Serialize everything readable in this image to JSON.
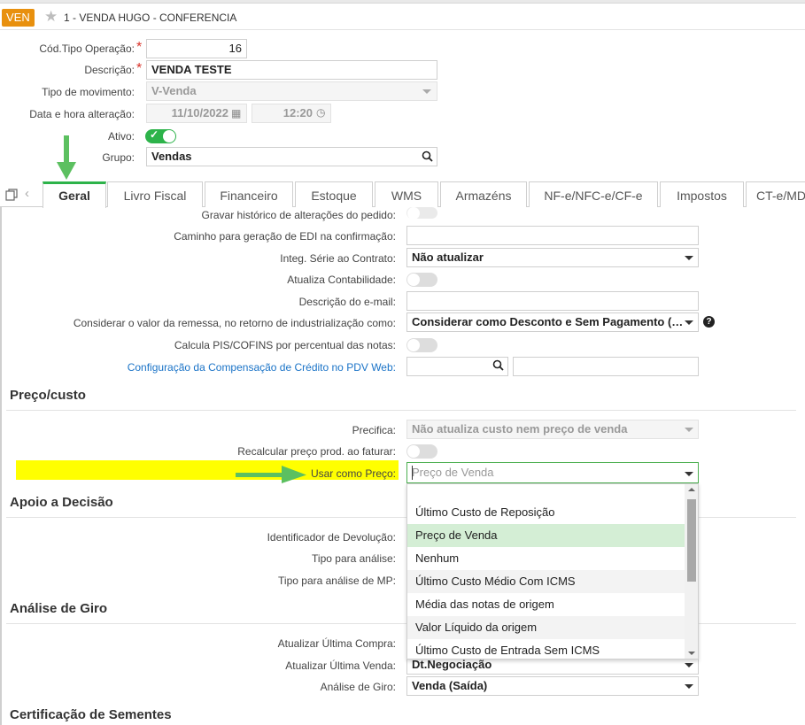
{
  "header": {
    "badge": "VEN",
    "title": "1 - VENDA HUGO - CONFERENCIA"
  },
  "form": {
    "cod_tipo_label": "Cód.Tipo Operação:",
    "cod_tipo_value": "16",
    "descricao_label": "Descrição:",
    "descricao_value": "VENDA TESTE",
    "tipo_mov_label": "Tipo de movimento:",
    "tipo_mov_value": "V-Venda",
    "data_label": "Data e hora alteração:",
    "data_value": "11/10/2022",
    "hora_value": "12:20",
    "ativo_label": "Ativo:",
    "grupo_label": "Grupo:",
    "grupo_value": "Vendas"
  },
  "tabs": [
    "Geral",
    "Livro Fiscal",
    "Financeiro",
    "Estoque",
    "WMS",
    "Armazéns",
    "NF-e/NFC-e/CF-e",
    "Impostos",
    "CT-e/MD"
  ],
  "geral": {
    "gravar_hist_label": "Gravar histórico de alterações do pedido:",
    "caminho_edi_label": "Caminho para geração de EDI na confirmação:",
    "integ_serie_label": "Integ. Série ao Contrato:",
    "integ_serie_value": "Não atualizar",
    "atualiza_contab_label": "Atualiza Contabilidade:",
    "desc_email_label": "Descrição do e-mail:",
    "considerar_label": "Considerar o valor da remessa, no retorno de industrialização como:",
    "considerar_value": "Considerar como Desconto e Sem Pagamento (…",
    "calcula_pis_label": "Calcula PIS/COFINS por percentual das notas:",
    "config_link": "Configuração da Compensação de Crédito no PDV Web:"
  },
  "preco": {
    "title": "Preço/custo",
    "precifica_label": "Precifica:",
    "precifica_value": "Não atualiza custo nem preço de venda",
    "recalcular_label": "Recalcular preço prod. ao faturar:",
    "usar_label": "Usar como Preço:",
    "usar_value": "Preço de Venda"
  },
  "apoio": {
    "title": "Apoio a Decisão",
    "identificador_label": "Identificador de Devolução:",
    "tipo_analise_label": "Tipo para análise:",
    "tipo_analise_mp_label": "Tipo para análise de MP:"
  },
  "giro": {
    "title": "Análise de Giro",
    "ultima_compra_label": "Atualizar Última Compra:",
    "ultima_venda_label": "Atualizar Última Venda:",
    "ultima_venda_value": "Dt.Negociação",
    "analise_giro_label": "Análise de Giro:",
    "analise_giro_value": "Venda (Saída)"
  },
  "sementes": {
    "title": "Certificação de Sementes"
  },
  "dropdown": {
    "options": [
      "Último Custo de Reposição",
      "Preço de Venda",
      "Nenhum",
      "Último Custo Médio Com ICMS",
      "Média das notas de origem",
      "Valor Líquido da origem",
      "Último Custo de Entrada Sem ICMS"
    ],
    "selected": "Preço de Venda"
  },
  "colors": {
    "accent_green": "#2db34a",
    "badge_orange": "#e8900e",
    "highlight_yellow": "#ffff00",
    "arrow_green": "#5cc060",
    "link_blue": "#1a73c7",
    "required_red": "#d9342b"
  }
}
